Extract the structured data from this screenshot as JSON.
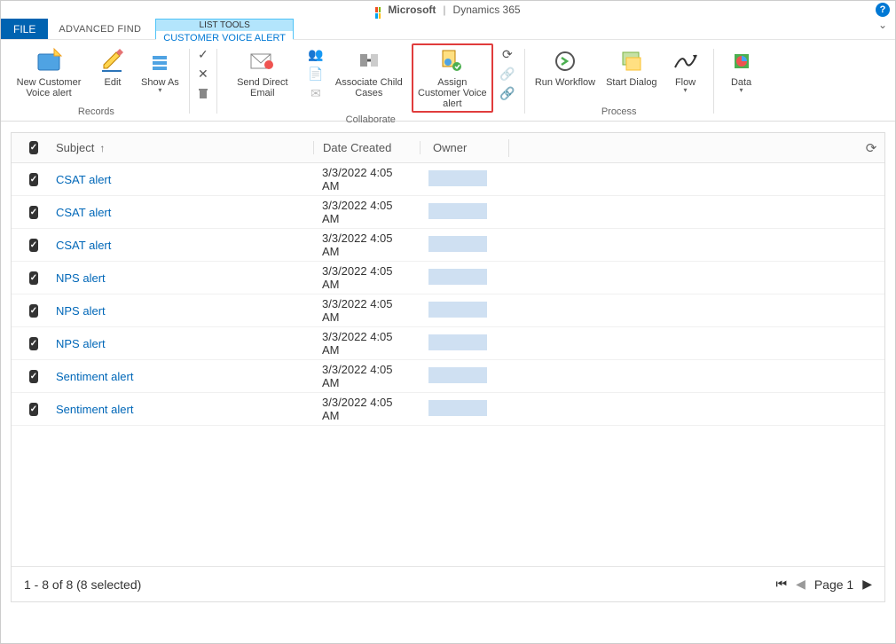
{
  "header": {
    "brand_prefix": "Microsoft",
    "brand_name": "Dynamics 365"
  },
  "tabs": {
    "file": "FILE",
    "advanced_find": "ADVANCED FIND",
    "list_tools": "LIST TOOLS",
    "customer_voice_alert": "CUSTOMER VOICE ALERT"
  },
  "ribbon": {
    "records": {
      "label": "Records",
      "new_alert": "New Customer Voice alert",
      "edit": "Edit",
      "show_as": "Show As"
    },
    "delete_group": {
      "delete_icon": "delete"
    },
    "collaborate": {
      "label": "Collaborate",
      "send_email": "Send Direct Email",
      "associate_child": "Associate Child Cases",
      "assign": "Assign Customer Voice alert"
    },
    "process": {
      "label": "Process",
      "run_workflow": "Run Workflow",
      "start_dialog": "Start Dialog",
      "flow": "Flow"
    },
    "data": {
      "label": "Data"
    }
  },
  "grid": {
    "columns": {
      "subject": "Subject",
      "date_created": "Date Created",
      "owner": "Owner"
    },
    "rows": [
      {
        "subject": "CSAT alert",
        "date": "3/3/2022 4:05 AM"
      },
      {
        "subject": "CSAT alert",
        "date": "3/3/2022 4:05 AM"
      },
      {
        "subject": "CSAT alert",
        "date": "3/3/2022 4:05 AM"
      },
      {
        "subject": "NPS alert",
        "date": "3/3/2022 4:05 AM"
      },
      {
        "subject": "NPS alert",
        "date": "3/3/2022 4:05 AM"
      },
      {
        "subject": "NPS alert",
        "date": "3/3/2022 4:05 AM"
      },
      {
        "subject": "Sentiment alert",
        "date": "3/3/2022 4:05 AM"
      },
      {
        "subject": "Sentiment alert",
        "date": "3/3/2022 4:05 AM"
      }
    ],
    "footer": {
      "range": "1 - 8 of 8 (8 selected)",
      "page": "Page 1"
    }
  }
}
